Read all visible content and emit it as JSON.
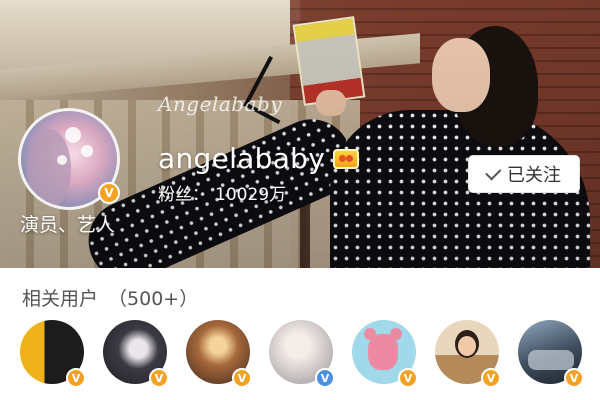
{
  "profile": {
    "watermark": "Angelababy",
    "name": "angelababy",
    "role": "演员、艺人",
    "fans_label": "粉丝：",
    "fans_value": "10029万",
    "verified_badge": "V",
    "verified_color": "#f3a226",
    "vip_icon": "vip-crown-icon"
  },
  "follow_button": {
    "label": "已关注",
    "icon": "check-icon"
  },
  "related": {
    "title": "相关用户",
    "count": "（500+）",
    "users": [
      {
        "badge": "V",
        "badge_color": "gold"
      },
      {
        "badge": "V",
        "badge_color": "gold"
      },
      {
        "badge": "V",
        "badge_color": "gold"
      },
      {
        "badge": "V",
        "badge_color": "blue"
      },
      {
        "badge": "V",
        "badge_color": "gold"
      },
      {
        "badge": "V",
        "badge_color": "gold"
      },
      {
        "badge": "V",
        "badge_color": "gold"
      }
    ]
  },
  "colors": {
    "badge_gold": "#f3a226",
    "badge_blue": "#4a90e2",
    "text_primary": "#333333",
    "text_muted": "#555555"
  }
}
